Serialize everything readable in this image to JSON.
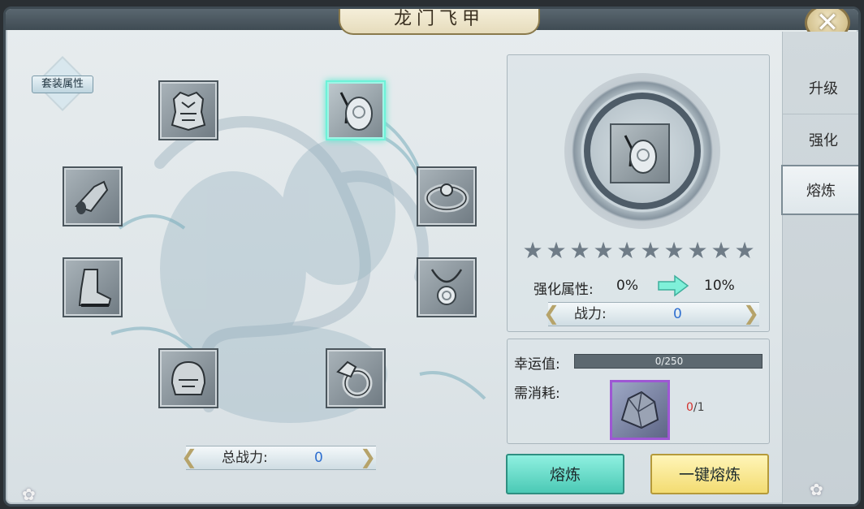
{
  "window": {
    "title": "龙门飞甲"
  },
  "set_attribute": {
    "label": "套装属性"
  },
  "equipment_slots": [
    {
      "name": "armor",
      "icon": "armor-icon"
    },
    {
      "name": "pendant",
      "icon": "jade-pendant-icon",
      "selected": true
    },
    {
      "name": "bracer",
      "icon": "bracer-icon"
    },
    {
      "name": "belt",
      "icon": "belt-icon"
    },
    {
      "name": "boots",
      "icon": "boots-icon"
    },
    {
      "name": "necklace",
      "icon": "necklace-icon"
    },
    {
      "name": "helmet",
      "icon": "helmet-icon"
    },
    {
      "name": "ring",
      "icon": "dragon-ring-icon"
    }
  ],
  "total_power": {
    "label": "总战力:",
    "value": "0"
  },
  "detail": {
    "stars_total": 10,
    "stars_filled": 0,
    "attribute": {
      "label": "强化属性:",
      "from": "0%",
      "to": "10%"
    },
    "power": {
      "label": "战力:",
      "value": "0"
    }
  },
  "luck": {
    "label": "幸运值:",
    "current": 0,
    "max": 250,
    "text": "0/250"
  },
  "cost": {
    "label": "需消耗:",
    "have": "0",
    "need": "/1",
    "icon": "crystal-ore-icon"
  },
  "buttons": {
    "smelt": "熔炼",
    "smelt_all": "一键熔炼"
  },
  "tabs": [
    {
      "label": "升级"
    },
    {
      "label": "强化"
    },
    {
      "label": "熔炼",
      "active": true
    }
  ],
  "colors": {
    "accent_teal": "#5de8d0",
    "accent_gold": "#f3dc72",
    "cost_border": "#9e57d4",
    "power_value": "#2f6fd0"
  }
}
